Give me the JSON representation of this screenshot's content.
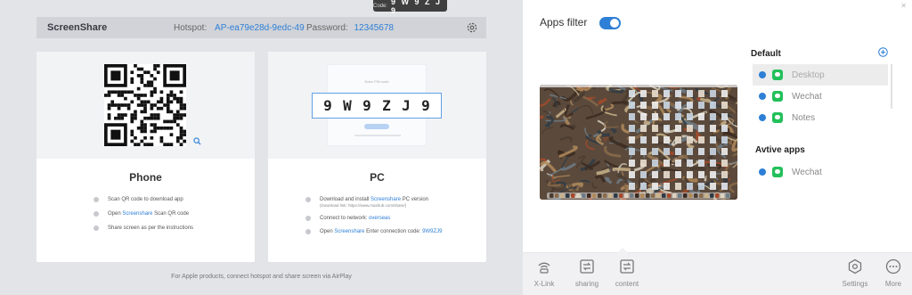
{
  "code_chip": {
    "label": "Code:",
    "value": "9 W 9 Z J 9"
  },
  "header": {
    "brand": "ScreenShare",
    "hotspot_label": "Hotspot:",
    "hotspot_value": "AP-ea79e28d-9edc-49",
    "password_label": "Password:",
    "password_value": "12345678",
    "settings_icon": "gear-icon"
  },
  "phone_card": {
    "title": "Phone",
    "steps": [
      {
        "text": "Scan QR code to download app"
      },
      {
        "pre": "Open",
        "link": "Screenshare",
        "post": "Scan QR code"
      },
      {
        "text": "Share screen as per the instructions"
      }
    ]
  },
  "pc_card": {
    "title": "PC",
    "pin": [
      "9",
      "W",
      "9",
      "Z",
      "J",
      "9"
    ],
    "mock_title": "Enter PIN code",
    "steps": [
      {
        "pre": "Download and install",
        "link": "Screenshare",
        "post": "PC version",
        "sub": "(Download link: https://www.maxhub.com/share/)"
      },
      {
        "pre": "Connect to network:",
        "link": "overseas"
      },
      {
        "pre": "Open",
        "link": "Screenshare",
        "post": "Enter connection code:",
        "code": "9W9ZJ9"
      }
    ]
  },
  "footnote": "For Apple products, connect hotspot and share screen via AirPlay",
  "apps_filter": {
    "label": "Apps filter",
    "enabled": true,
    "default_title": "Default",
    "default_apps": [
      {
        "name": "Desktop",
        "selected": true
      },
      {
        "name": "Wechat",
        "selected": false
      },
      {
        "name": "Notes",
        "selected": false
      }
    ],
    "active_title": "Avtive apps",
    "active_apps": [
      {
        "name": "Wechat"
      }
    ]
  },
  "bottom_bar": {
    "xlink": "X-Link",
    "sharing": "sharing",
    "content": "content",
    "settings": "Settings",
    "more": "More"
  },
  "colors": {
    "accent": "#2e7fd6",
    "app_green": "#23c05a",
    "panel_bg": "#e3e4e7"
  }
}
